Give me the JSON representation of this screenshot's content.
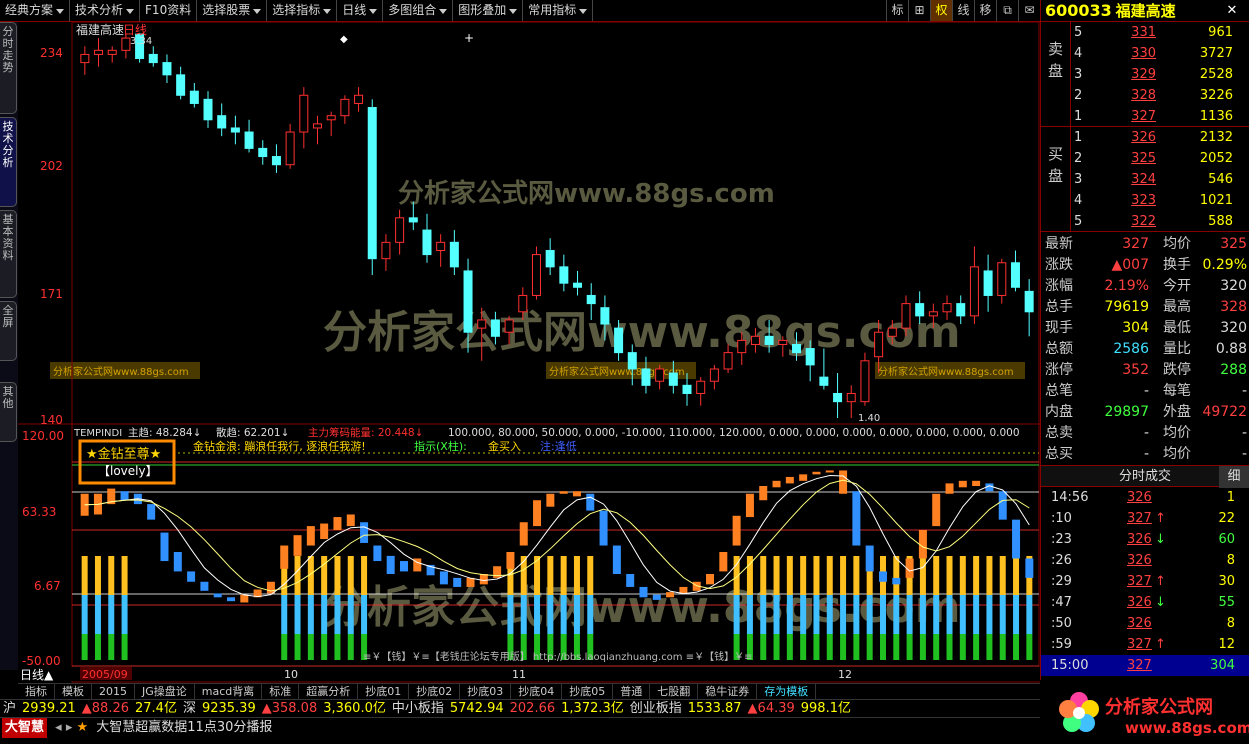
{
  "menu": [
    {
      "label": "经典方案",
      "drop": true
    },
    {
      "label": "技术分析",
      "drop": true
    },
    {
      "label": "F10资料",
      "drop": false
    },
    {
      "label": "选择股票",
      "drop": true
    },
    {
      "label": "选择指标",
      "drop": true
    },
    {
      "label": "日线",
      "drop": true
    },
    {
      "label": "多图组合",
      "drop": true
    },
    {
      "label": "图形叠加",
      "drop": true
    },
    {
      "label": "常用指标",
      "drop": true
    }
  ],
  "toolbar": {
    "b1": "标",
    "b2": "⊞",
    "b3": "权",
    "b4": "线",
    "b5": "移",
    "b6": "⧉",
    "b7": "✉"
  },
  "left_tabs": [
    "分时走势",
    "技术分析",
    "基本资料",
    "全屏",
    "其他"
  ],
  "chart": {
    "stock_title": "福建高速",
    "period": "日线",
    "max_label": "3.34",
    "min_label": "1.40",
    "price_ticks": [
      "234",
      "202",
      "171",
      "140"
    ],
    "ind_ticks": [
      "120.00",
      "63.33",
      "6.67",
      "-50.00"
    ],
    "date_labels": [
      "2005/09",
      "10",
      "11",
      "12"
    ],
    "ind_line1": {
      "name": "TEMPINDI",
      "a": "主趋: 48.284↓",
      "b": "散趋: 62.201↓",
      "c": "主力筹码能量: 20.448↓",
      "rest": "100.000, 80.000, 50.000, 0.000, -10.000, 110.000, 120.000, 0.000, 0.000, 0.000, 0.000, 0.000, 0.000, 0.000"
    },
    "ind_line2": {
      "a": "金钻金浪: 蹦浪任我行, 逐浪任我游!",
      "b": "指示(X柱):",
      "c": "金买入",
      "d": "注:逢低"
    },
    "badge_title": "★金钻至尊★",
    "badge_sub": "【lovely】",
    "signature": "≡￥【钱】￥≡【老钱庄论坛专用版】 http://bbs.laoqianzhuang.com ≡￥【钱】￥≡",
    "watermark1": "分析家公式网www.88gs.com",
    "watermark2": "分析家公式网www.88gs.com",
    "watermark3": "分析家公式网www.88gs.com",
    "wm_small": "分析家公式网www.88gs.com",
    "period_indicator": "日线▲",
    "candles": [
      [
        227,
        231,
        224,
        229
      ],
      [
        229,
        233,
        226,
        230
      ],
      [
        229,
        231,
        227,
        230
      ],
      [
        230,
        234,
        228,
        233
      ],
      [
        234,
        234,
        227,
        228
      ],
      [
        229,
        231,
        226,
        227
      ],
      [
        227,
        229,
        222,
        224
      ],
      [
        224,
        226,
        218,
        219
      ],
      [
        220,
        222,
        216,
        217
      ],
      [
        218,
        220,
        211,
        213
      ],
      [
        214,
        217,
        209,
        211
      ],
      [
        211,
        214,
        207,
        210
      ],
      [
        210,
        213,
        205,
        206
      ],
      [
        206,
        208,
        202,
        204
      ],
      [
        204,
        207,
        200,
        202
      ],
      [
        202,
        212,
        201,
        210
      ],
      [
        210,
        221,
        206,
        219
      ],
      [
        211,
        214,
        207,
        212
      ],
      [
        213,
        215,
        209,
        214
      ],
      [
        214,
        219,
        212,
        218
      ],
      [
        217,
        221,
        215,
        219
      ],
      [
        216,
        218,
        175,
        179
      ],
      [
        179,
        185,
        176,
        183
      ],
      [
        183,
        191,
        180,
        189
      ],
      [
        189,
        193,
        186,
        188
      ],
      [
        186,
        190,
        178,
        180
      ],
      [
        181,
        185,
        177,
        183
      ],
      [
        183,
        186,
        175,
        177
      ],
      [
        176,
        179,
        156,
        161
      ],
      [
        162,
        167,
        154,
        164
      ],
      [
        164,
        166,
        158,
        160
      ],
      [
        161,
        165,
        158,
        164
      ],
      [
        166,
        172,
        164,
        170
      ],
      [
        170,
        182,
        169,
        180
      ],
      [
        181,
        184,
        175,
        177
      ],
      [
        177,
        180,
        171,
        173
      ],
      [
        173,
        176,
        170,
        172
      ],
      [
        170,
        173,
        164,
        168
      ],
      [
        167,
        170,
        159,
        163
      ],
      [
        162,
        164,
        154,
        156
      ],
      [
        156,
        158,
        148,
        152
      ],
      [
        152,
        155,
        146,
        148
      ],
      [
        149,
        153,
        147,
        152
      ],
      [
        151,
        154,
        146,
        148
      ],
      [
        148,
        151,
        143,
        146
      ],
      [
        146,
        150,
        143,
        149
      ],
      [
        149,
        153,
        147,
        152
      ],
      [
        152,
        158,
        151,
        156
      ],
      [
        156,
        161,
        153,
        159
      ],
      [
        158,
        162,
        156,
        160
      ],
      [
        160,
        164,
        156,
        158
      ],
      [
        158,
        160,
        155,
        159
      ],
      [
        158,
        161,
        154,
        156
      ],
      [
        157,
        159,
        149,
        153
      ],
      [
        150,
        157,
        147,
        148
      ],
      [
        146,
        151,
        140,
        144
      ],
      [
        144,
        148,
        140,
        146
      ],
      [
        144,
        156,
        143,
        154
      ],
      [
        155,
        164,
        151,
        161
      ],
      [
        160,
        164,
        158,
        162
      ],
      [
        162,
        170,
        160,
        168
      ],
      [
        168,
        171,
        163,
        165
      ],
      [
        165,
        168,
        162,
        166
      ],
      [
        166,
        170,
        164,
        168
      ],
      [
        168,
        170,
        163,
        165
      ],
      [
        165,
        182,
        163,
        177
      ],
      [
        176,
        180,
        166,
        170
      ],
      [
        170,
        179,
        168,
        178
      ],
      [
        178,
        181,
        171,
        172
      ],
      [
        171,
        174,
        160,
        166
      ]
    ],
    "ind_bars": [
      [
        63,
        80
      ],
      [
        64,
        80
      ],
      [
        72,
        84
      ],
      [
        75,
        82
      ],
      [
        72,
        80
      ],
      [
        60,
        72
      ],
      [
        28,
        50
      ],
      [
        20,
        35
      ],
      [
        12,
        20
      ],
      [
        5,
        12
      ],
      [
        0,
        3
      ],
      [
        -3,
        0
      ],
      [
        -4,
        2
      ],
      [
        0,
        6
      ],
      [
        3,
        12
      ],
      [
        22,
        40
      ],
      [
        32,
        48
      ],
      [
        40,
        55
      ],
      [
        45,
        57
      ],
      [
        52,
        62
      ],
      [
        55,
        64
      ],
      [
        42,
        58
      ],
      [
        28,
        40
      ],
      [
        18,
        32
      ],
      [
        20,
        28
      ],
      [
        20,
        30
      ],
      [
        17,
        25
      ],
      [
        10,
        20
      ],
      [
        8,
        15
      ],
      [
        8,
        15
      ],
      [
        10,
        18
      ],
      [
        15,
        24
      ],
      [
        22,
        35
      ],
      [
        40,
        58
      ],
      [
        55,
        75
      ],
      [
        70,
        80
      ],
      [
        80,
        82
      ],
      [
        78,
        82
      ],
      [
        67,
        80
      ],
      [
        40,
        67
      ],
      [
        18,
        40
      ],
      [
        8,
        18
      ],
      [
        0,
        8
      ],
      [
        -2,
        2
      ],
      [
        0,
        4
      ],
      [
        3,
        8
      ],
      [
        5,
        12
      ],
      [
        10,
        18
      ],
      [
        20,
        35
      ],
      [
        40,
        63
      ],
      [
        62,
        80
      ],
      [
        75,
        86
      ],
      [
        85,
        90
      ],
      [
        88,
        93
      ],
      [
        90,
        95
      ],
      [
        95,
        97
      ],
      [
        97,
        98
      ],
      [
        80,
        98
      ],
      [
        40,
        82
      ],
      [
        20,
        40
      ],
      [
        12,
        20
      ],
      [
        10,
        15
      ],
      [
        15,
        30
      ],
      [
        30,
        52
      ],
      [
        55,
        80
      ],
      [
        80,
        88
      ],
      [
        85,
        90
      ],
      [
        86,
        90
      ],
      [
        82,
        88
      ],
      [
        60,
        82
      ],
      [
        30,
        60
      ],
      [
        15,
        30
      ]
    ],
    "vol_bars": [
      [
        1,
        2
      ],
      [
        1,
        2
      ],
      [
        1,
        2
      ],
      [
        1,
        2
      ],
      [
        0,
        0
      ],
      [
        0,
        0
      ],
      [
        0,
        0
      ],
      [
        0,
        0
      ],
      [
        0,
        0
      ],
      [
        0,
        0
      ],
      [
        0,
        0
      ],
      [
        0,
        0
      ],
      [
        0,
        0
      ],
      [
        0,
        0
      ],
      [
        0,
        0
      ],
      [
        1,
        2
      ],
      [
        1,
        2
      ],
      [
        1,
        2
      ],
      [
        1,
        2
      ],
      [
        1,
        2
      ],
      [
        1,
        2
      ],
      [
        1,
        2
      ],
      [
        0,
        0
      ],
      [
        0,
        0
      ],
      [
        0,
        0
      ],
      [
        0,
        0
      ],
      [
        0,
        0
      ],
      [
        0,
        0
      ],
      [
        0,
        0
      ],
      [
        0,
        0
      ],
      [
        0,
        0
      ],
      [
        0,
        0
      ],
      [
        1,
        2
      ],
      [
        1,
        2
      ],
      [
        1,
        2
      ],
      [
        1,
        2
      ],
      [
        1,
        2
      ],
      [
        1,
        2
      ],
      [
        1,
        2
      ],
      [
        0,
        0
      ],
      [
        0,
        0
      ],
      [
        0,
        0
      ],
      [
        0,
        0
      ],
      [
        0,
        0
      ],
      [
        0,
        0
      ],
      [
        0,
        0
      ],
      [
        0,
        0
      ],
      [
        0,
        0
      ],
      [
        0,
        0
      ],
      [
        1,
        2
      ],
      [
        1,
        2
      ],
      [
        1,
        2
      ],
      [
        1,
        2
      ],
      [
        1,
        2
      ],
      [
        1,
        2
      ],
      [
        1,
        2
      ],
      [
        1,
        2
      ],
      [
        1,
        2
      ],
      [
        0,
        1
      ],
      [
        0,
        1
      ],
      [
        0,
        1
      ],
      [
        0,
        1
      ],
      [
        1,
        2
      ],
      [
        1,
        2
      ],
      [
        1,
        2
      ],
      [
        1,
        2
      ],
      [
        1,
        2
      ],
      [
        1,
        2
      ],
      [
        0,
        1
      ],
      [
        0,
        1
      ],
      [
        0,
        1
      ],
      [
        0,
        1
      ]
    ]
  },
  "right": {
    "code": "600033",
    "name": "福建高速",
    "sell_label": "卖 盘",
    "buy_label": "买 盘",
    "asks": [
      {
        "l": "5",
        "p": "331",
        "v": "961"
      },
      {
        "l": "4",
        "p": "330",
        "v": "3727"
      },
      {
        "l": "3",
        "p": "329",
        "v": "2528"
      },
      {
        "l": "2",
        "p": "328",
        "v": "3226"
      },
      {
        "l": "1",
        "p": "327",
        "v": "1136"
      }
    ],
    "bids": [
      {
        "l": "1",
        "p": "326",
        "v": "2132"
      },
      {
        "l": "2",
        "p": "325",
        "v": "2052"
      },
      {
        "l": "3",
        "p": "324",
        "v": "546"
      },
      {
        "l": "4",
        "p": "323",
        "v": "1021"
      },
      {
        "l": "5",
        "p": "322",
        "v": "588"
      }
    ],
    "quotes": [
      {
        "k": "最新",
        "v": "327",
        "c": "red",
        "k2": "均价",
        "v2": "325",
        "c2": "red"
      },
      {
        "k": "涨跌",
        "v": "▲007",
        "c": "red",
        "k2": "换手",
        "v2": "0.29%",
        "c2": "yel"
      },
      {
        "k": "涨幅",
        "v": "2.19%",
        "c": "red",
        "k2": "今开",
        "v2": "320",
        "c2": "wht"
      },
      {
        "k": "总手",
        "v": "79619",
        "c": "yel",
        "k2": "最高",
        "v2": "328",
        "c2": "red"
      },
      {
        "k": "现手",
        "v": "304",
        "c": "yel",
        "k2": "最低",
        "v2": "320",
        "c2": "wht"
      },
      {
        "k": "总额",
        "v": "2586",
        "c": "cy",
        "k2": "量比",
        "v2": "0.88",
        "c2": "wht"
      },
      {
        "k": "涨停",
        "v": "352",
        "c": "red",
        "k2": "跌停",
        "v2": "288",
        "c2": "grn"
      },
      {
        "k": "总笔",
        "v": "-",
        "c": "wht",
        "k2": "每笔",
        "v2": "-",
        "c2": "wht"
      },
      {
        "k": "内盘",
        "v": "29897",
        "c": "grn",
        "k2": "外盘",
        "v2": "49722",
        "c2": "red"
      },
      {
        "k": "总卖",
        "v": "-",
        "c": "wht",
        "k2": "均价",
        "v2": "-",
        "c2": "wht"
      },
      {
        "k": "总买",
        "v": "-",
        "c": "wht",
        "k2": "均价",
        "v2": "-",
        "c2": "wht"
      }
    ],
    "tick_header": "分时成交",
    "tick_btn": "细",
    "ticks": [
      {
        "t": "14:56",
        "p": "326",
        "arrow": "",
        "v": "1",
        "c": "red"
      },
      {
        "t": ":10",
        "p": "327",
        "arrow": "↑",
        "v": "22",
        "c": "red"
      },
      {
        "t": ":23",
        "p": "326",
        "arrow": "↓",
        "v": "60",
        "c": "grn"
      },
      {
        "t": ":26",
        "p": "326",
        "arrow": "",
        "v": "8",
        "c": "red"
      },
      {
        "t": ":29",
        "p": "327",
        "arrow": "↑",
        "v": "30",
        "c": "red"
      },
      {
        "t": ":47",
        "p": "326",
        "arrow": "↓",
        "v": "55",
        "c": "grn"
      },
      {
        "t": ":50",
        "p": "326",
        "arrow": "",
        "v": "8",
        "c": "red"
      },
      {
        "t": ":59",
        "p": "327",
        "arrow": "↑",
        "v": "12",
        "c": "red"
      },
      {
        "t": "15:00",
        "p": "327",
        "arrow": "",
        "v": "304",
        "c": "grn"
      }
    ]
  },
  "bottom_tabs": [
    "指标",
    "模板",
    "2015",
    "JG操盘论",
    "macd背离",
    "标准",
    "超赢分析",
    "抄底01",
    "抄底02",
    "抄底03",
    "抄底04",
    "抄底05",
    "普通",
    "七股翻",
    "稳牛证券",
    "存为模板"
  ],
  "status": [
    {
      "t": "沪",
      "c": "wht"
    },
    {
      "t": "2939.21",
      "c": "yel"
    },
    {
      "t": "▲88.26",
      "c": "red"
    },
    {
      "t": "27.4亿",
      "c": "yel"
    },
    {
      "t": "深",
      "c": "wht"
    },
    {
      "t": "9235.39",
      "c": "yel"
    },
    {
      "t": "▲358.08",
      "c": "red"
    },
    {
      "t": "3,360.0亿",
      "c": "yel"
    },
    {
      "t": "中小板指",
      "c": "wht"
    },
    {
      "t": "5742.94",
      "c": "yel"
    },
    {
      "t": "202.66",
      "c": "red"
    },
    {
      "t": "1,372.3亿",
      "c": "yel"
    },
    {
      "t": "创业板指",
      "c": "wht"
    },
    {
      "t": "1533.87",
      "c": "yel"
    },
    {
      "t": "▲64.39",
      "c": "red"
    },
    {
      "t": "998.1亿",
      "c": "yel"
    }
  ],
  "news": {
    "logo": "大智慧",
    "text": "大智慧超赢数据11点30分播报"
  },
  "brand": {
    "name": "分析家公式网",
    "url": "www.88gs.com"
  },
  "colors": {
    "up": "#ff3030",
    "down": "#54ffff",
    "frame": "#800000"
  }
}
